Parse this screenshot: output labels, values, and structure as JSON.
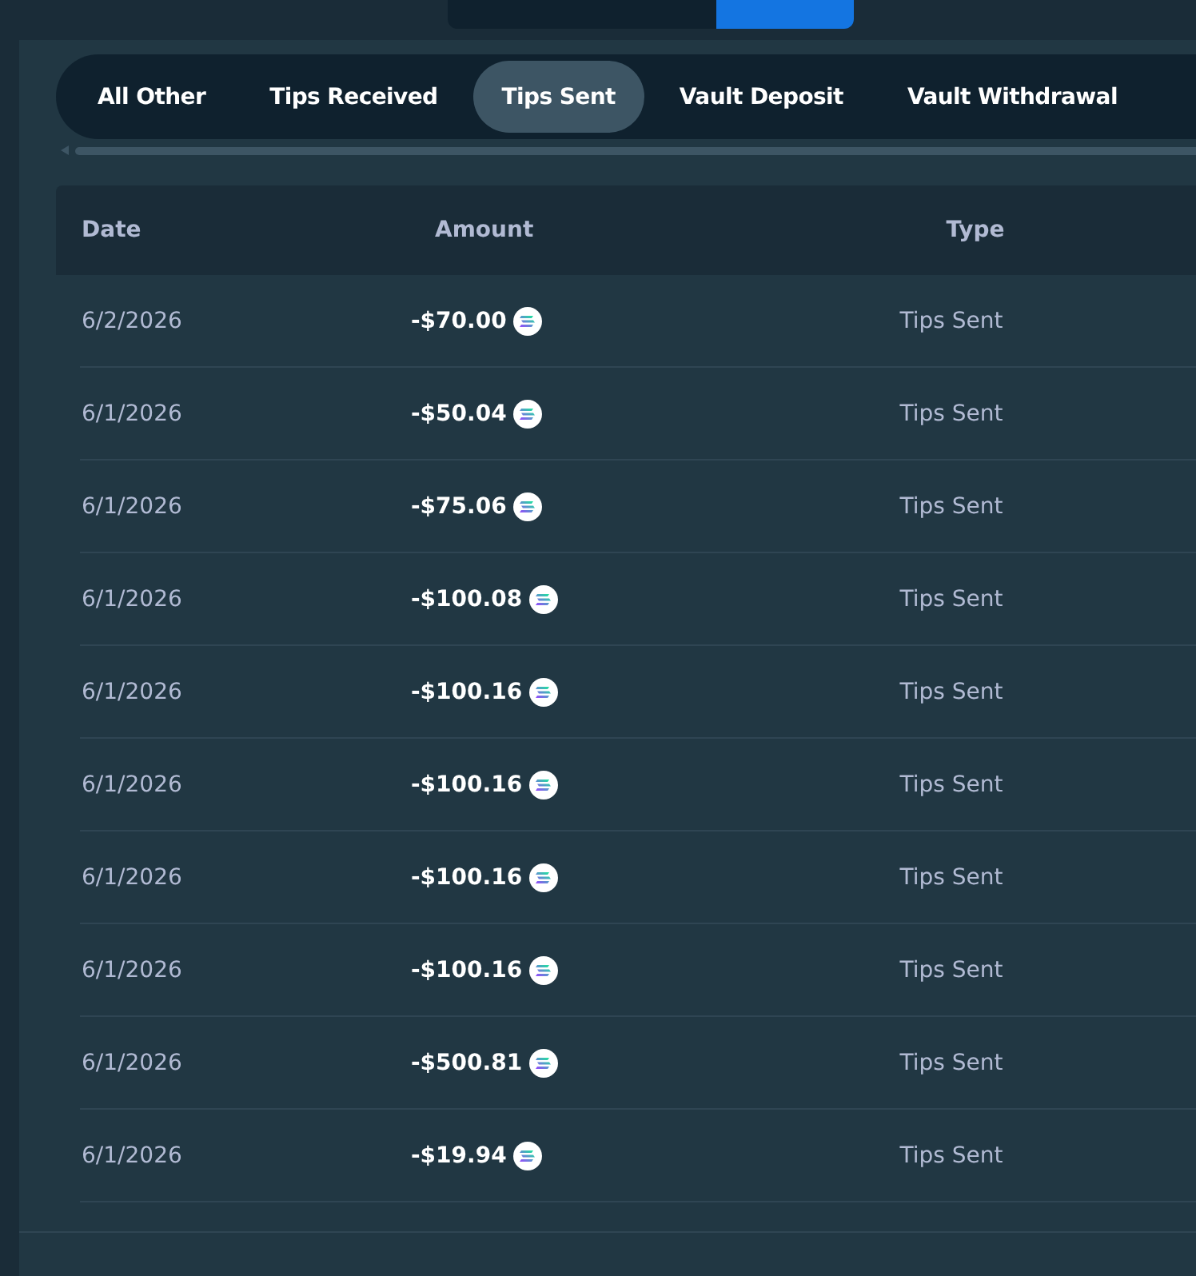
{
  "tabs": [
    {
      "label": "All Other",
      "selected": false
    },
    {
      "label": "Tips Received",
      "selected": false
    },
    {
      "label": "Tips Sent",
      "selected": true
    },
    {
      "label": "Vault Deposit",
      "selected": false
    },
    {
      "label": "Vault Withdrawal",
      "selected": false
    }
  ],
  "table": {
    "columns": [
      "Date",
      "Amount",
      "Type"
    ],
    "rows": [
      {
        "date": "6/2/2026",
        "amount": "-$70.00",
        "type": "Tips Sent"
      },
      {
        "date": "6/1/2026",
        "amount": "-$50.04",
        "type": "Tips Sent"
      },
      {
        "date": "6/1/2026",
        "amount": "-$75.06",
        "type": "Tips Sent"
      },
      {
        "date": "6/1/2026",
        "amount": "-$100.08",
        "type": "Tips Sent"
      },
      {
        "date": "6/1/2026",
        "amount": "-$100.16",
        "type": "Tips Sent"
      },
      {
        "date": "6/1/2026",
        "amount": "-$100.16",
        "type": "Tips Sent"
      },
      {
        "date": "6/1/2026",
        "amount": "-$100.16",
        "type": "Tips Sent"
      },
      {
        "date": "6/1/2026",
        "amount": "-$100.16",
        "type": "Tips Sent"
      },
      {
        "date": "6/1/2026",
        "amount": "-$500.81",
        "type": "Tips Sent"
      },
      {
        "date": "6/1/2026",
        "amount": "-$19.94",
        "type": "Tips Sent"
      }
    ]
  }
}
